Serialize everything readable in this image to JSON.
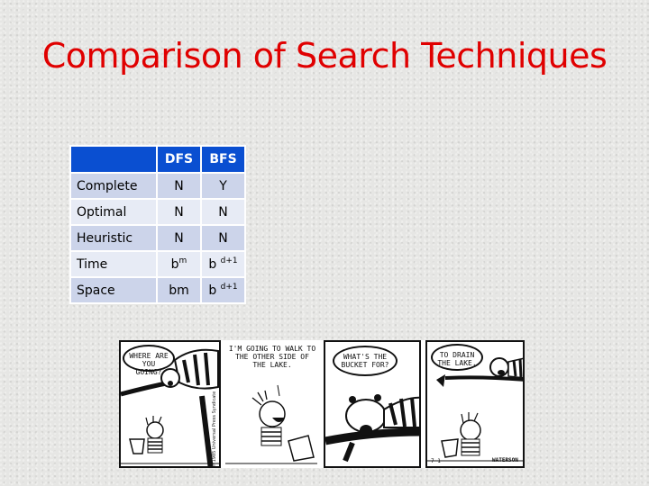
{
  "slide": {
    "title": "Comparison of Search Techniques",
    "colors": {
      "title": "#e00000",
      "header_bg": "#0a4fd1",
      "row_odd": "#ccd4ea",
      "row_even": "#e7ebf5"
    }
  },
  "table": {
    "headers": [
      "",
      "DFS",
      "BFS"
    ],
    "rows": [
      {
        "label": "Complete",
        "dfs": "N",
        "bfs": "Y"
      },
      {
        "label": "Optimal",
        "dfs": "N",
        "bfs": "N"
      },
      {
        "label": "Heuristic",
        "dfs": "N",
        "bfs": "N"
      },
      {
        "label": "Time",
        "dfs_base": "b",
        "dfs_sup": "m",
        "bfs_base": "b",
        "bfs_sup": "d+1"
      },
      {
        "label": "Space",
        "dfs": "bm",
        "bfs_base": "b",
        "bfs_sup": "d+1"
      }
    ]
  },
  "comic": {
    "panels": [
      {
        "text": "WHERE ARE\nYOU GOING?"
      },
      {
        "text": "I'M GOING TO WALK TO\nTHE OTHER SIDE OF\nTHE LAKE."
      },
      {
        "text": "WHAT'S THE\nBUCKET FOR?"
      },
      {
        "text": "TO DRAIN\nTHE LAKE."
      }
    ],
    "copyright": "© 1985 Universal Press Syndicate",
    "signature": "WATERSON",
    "date": "7-1"
  }
}
